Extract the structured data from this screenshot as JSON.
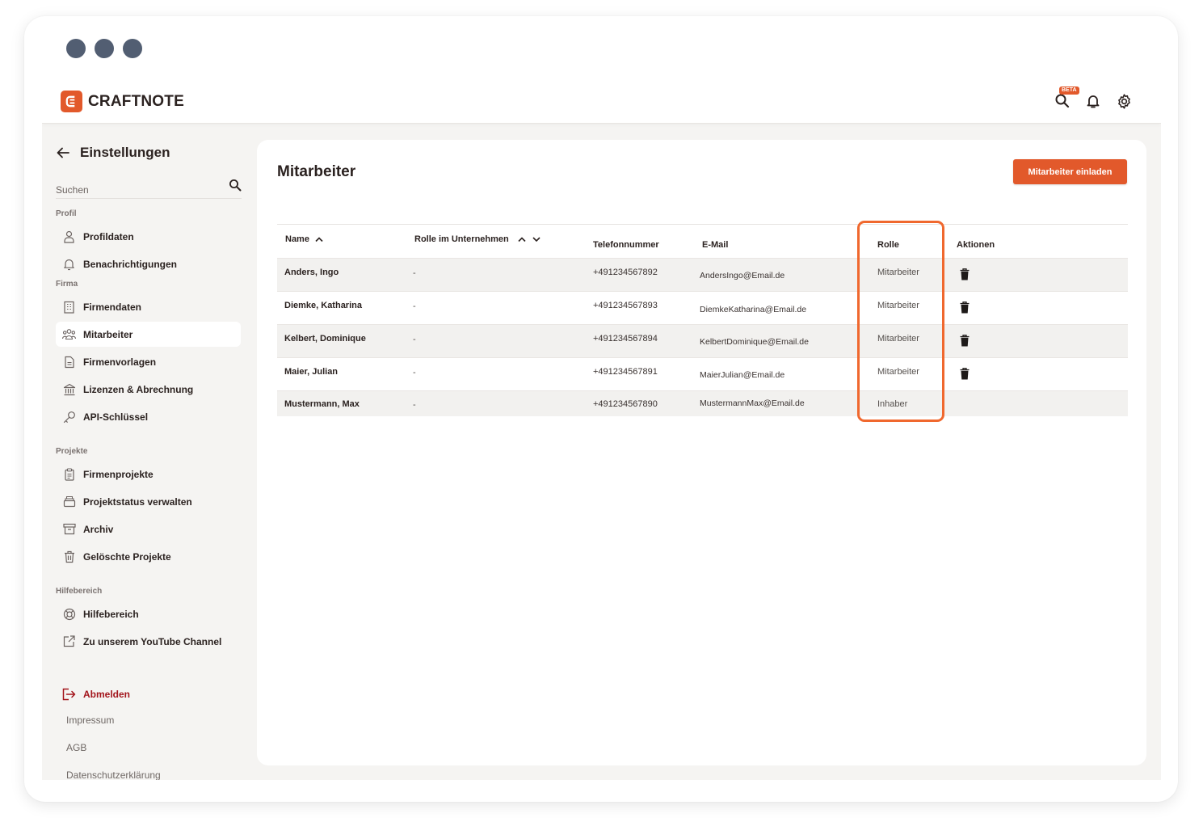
{
  "app": {
    "logo_text": "CRAFTNOTE",
    "beta_badge": "BETA",
    "brand_color": "#e2592b"
  },
  "sidebar": {
    "back_title": "Einstellungen",
    "search_placeholder": "Suchen",
    "sections": {
      "profil": "Profil",
      "firma": "Firma",
      "projekte": "Projekte",
      "hilfe": "Hilfebereich"
    },
    "items": [
      {
        "label": "Profildaten",
        "icon": "user-icon"
      },
      {
        "label": "Benachrichtigungen",
        "icon": "bell-icon"
      },
      {
        "label": "Firmendaten",
        "icon": "building-icon"
      },
      {
        "label": "Mitarbeiter",
        "icon": "team-icon",
        "active": true
      },
      {
        "label": "Firmenvorlagen",
        "icon": "document-icon"
      },
      {
        "label": "Lizenzen & Abrechnung",
        "icon": "bank-icon"
      },
      {
        "label": "API-Schlüssel",
        "icon": "key-icon"
      },
      {
        "label": "Firmenprojekte",
        "icon": "clipboard-icon"
      },
      {
        "label": "Projektstatus verwalten",
        "icon": "stack-icon"
      },
      {
        "label": "Archiv",
        "icon": "archive-icon"
      },
      {
        "label": "Gelöschte Projekte",
        "icon": "trash-icon"
      },
      {
        "label": "Hilfebereich",
        "icon": "lifebuoy-icon"
      },
      {
        "label": "Zu unserem YouTube Channel",
        "icon": "external-link-icon"
      }
    ],
    "logout": "Abmelden",
    "footer_links": [
      "Impressum",
      "AGB",
      "Datenschutzerklärung"
    ]
  },
  "main": {
    "title": "Mitarbeiter",
    "invite_button": "Mitarbeiter einladen",
    "columns": {
      "name": "Name",
      "rolle_unternehmen": "Rolle im Unternehmen",
      "telefon": "Telefonnummer",
      "email": "E-Mail",
      "rolle": "Rolle",
      "aktionen": "Aktionen"
    },
    "rows": [
      {
        "name": "Anders, Ingo",
        "rolle_unternehmen": "-",
        "telefon": "+491234567892",
        "email": "AndersIngo@Email.de",
        "rolle": "Mitarbeiter",
        "deletable": true
      },
      {
        "name": "Diemke, Katharina",
        "rolle_unternehmen": "-",
        "telefon": "+491234567893",
        "email": "DiemkeKatharina@Email.de",
        "rolle": "Mitarbeiter",
        "deletable": true
      },
      {
        "name": "Kelbert, Dominique",
        "rolle_unternehmen": "-",
        "telefon": "+491234567894",
        "email": "KelbertDominique@Email.de",
        "rolle": "Mitarbeiter",
        "deletable": true
      },
      {
        "name": "Maier, Julian",
        "rolle_unternehmen": "-",
        "telefon": "+491234567891",
        "email": "MaierJulian@Email.de",
        "rolle": "Mitarbeiter",
        "deletable": true
      },
      {
        "name": "Mustermann, Max",
        "rolle_unternehmen": "-",
        "telefon": "+491234567890",
        "email": "MustermannMax@Email.de",
        "rolle": "Inhaber",
        "deletable": false
      }
    ],
    "highlight_color": "#f0682e"
  }
}
